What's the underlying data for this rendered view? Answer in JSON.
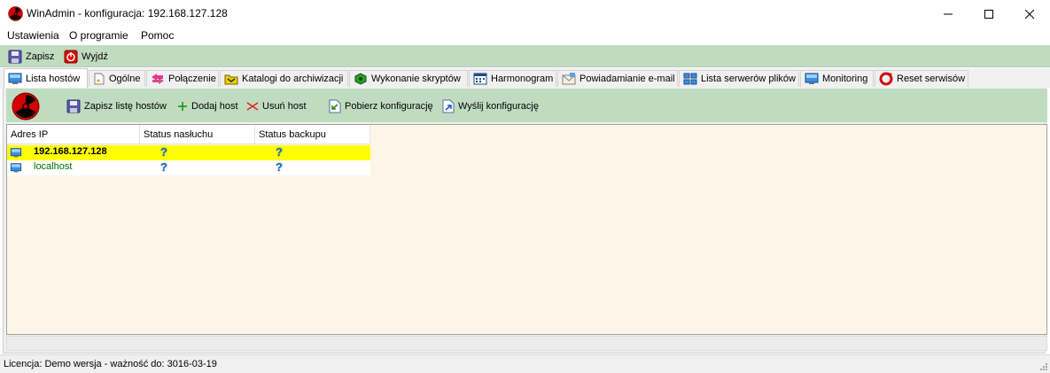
{
  "window": {
    "title": "WinAdmin - konfiguracja: 192.168.127.128",
    "app_icon": "radiation-icon",
    "controls": [
      "minimize",
      "maximize",
      "close"
    ]
  },
  "menu": {
    "items": [
      "Ustawienia",
      "O programie",
      "Pomoc"
    ]
  },
  "toolbar": {
    "save_label": "Zapisz",
    "save_icon": "floppy-disk-icon",
    "exit_label": "Wyjdź",
    "exit_icon": "power-icon"
  },
  "tabs": [
    {
      "label": "Lista hostów",
      "icon": "monitor-icon",
      "active": true
    },
    {
      "label": "Ogólne",
      "icon": "document-icon"
    },
    {
      "label": "Połączenie",
      "icon": "connection-arrows-icon"
    },
    {
      "label": "Katalogi do archiwizacji",
      "icon": "folders-icon"
    },
    {
      "label": "Wykonanie skryptów",
      "icon": "gear-box-icon"
    },
    {
      "label": "Harmonogram",
      "icon": "calendar-icon"
    },
    {
      "label": "Powiadamianie e-mail",
      "icon": "envelope-icon"
    },
    {
      "label": "Lista serwerów plików",
      "icon": "servers-icon"
    },
    {
      "label": "Monitoring",
      "icon": "monitor-icon"
    },
    {
      "label": "Reset serwisów",
      "icon": "reset-icon"
    }
  ],
  "hosts_toolbar": {
    "logo_icon": "radiation-icon",
    "save_list_label": "Zapisz listę hostów",
    "add_host_label": "Dodaj host",
    "remove_host_label": "Usuń host",
    "fetch_config_label": "Pobierz konfigurację",
    "send_config_label": "Wyślij konfigurację"
  },
  "grid": {
    "columns": [
      "Adres IP",
      "Status nasłuchu",
      "Status backupu"
    ],
    "rows": [
      {
        "ip": "192.168.127.128",
        "listen_status": "?",
        "backup_status": "?",
        "selected": true
      },
      {
        "ip": "localhost",
        "listen_status": "?",
        "backup_status": "?",
        "selected": false
      }
    ]
  },
  "status": {
    "license": "Licencja: Demo wersja - ważność do: 3016-03-19"
  },
  "colors": {
    "toolbar_green": "#c0dcc0",
    "selection_yellow": "#ffff00",
    "grid_background": "#fdf6e8",
    "localhost_text": "#007000",
    "question_blue": "#1a6fd0"
  }
}
